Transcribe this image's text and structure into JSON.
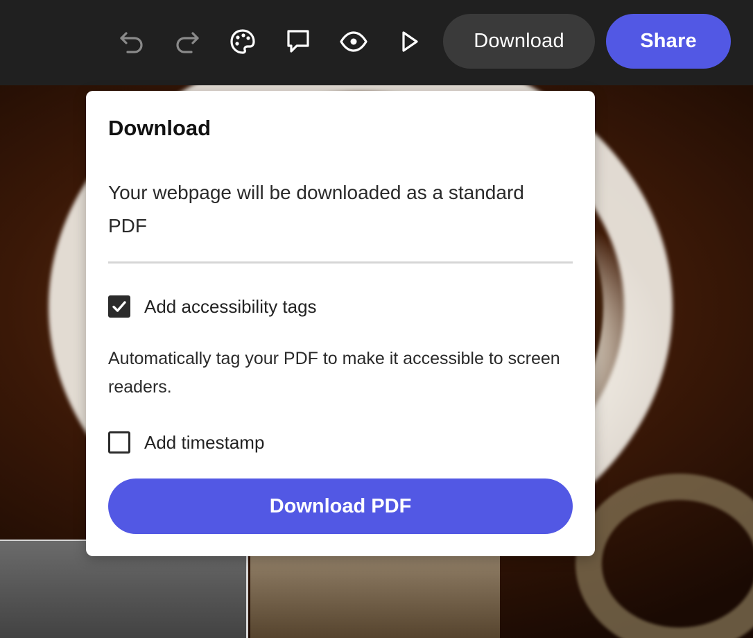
{
  "toolbar": {
    "icons": {
      "undo": "undo-icon",
      "redo": "redo-icon",
      "theme": "palette-icon",
      "comment": "comment-icon",
      "preview": "eye-icon",
      "present": "play-icon"
    },
    "download_label": "Download",
    "share_label": "Share"
  },
  "download_popover": {
    "title": "Download",
    "description": "Your webpage will be downloaded as a standard PDF",
    "options": [
      {
        "label": "Add accessibility tags",
        "checked": true
      },
      {
        "label": "Add timestamp",
        "checked": false
      }
    ],
    "accessibility_help": "Automatically tag your PDF to make it accessible to screen readers.",
    "cta_label": "Download PDF"
  },
  "colors": {
    "accent": "#5258e4",
    "toolbar_bg": "#202020",
    "download_button_bg": "#3a3a3a"
  }
}
